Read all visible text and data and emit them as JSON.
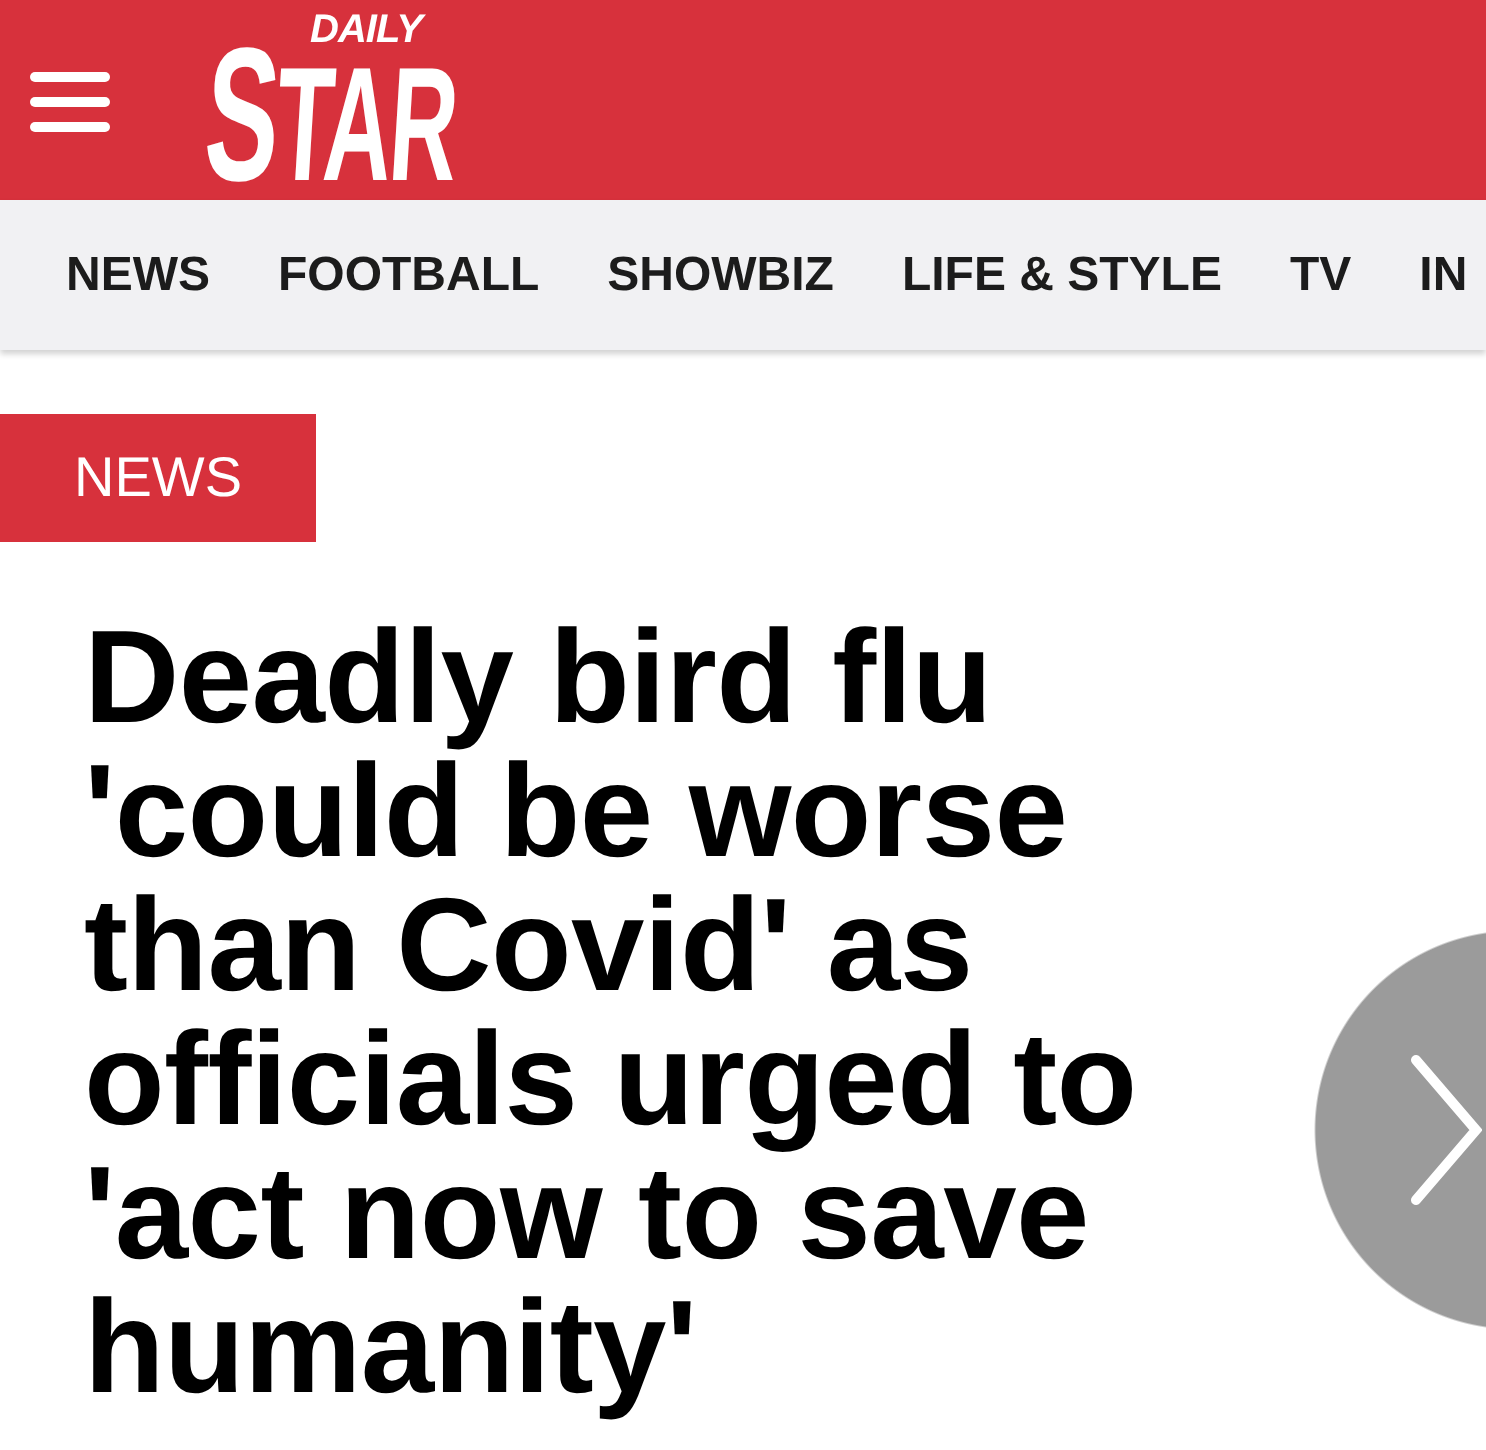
{
  "header": {
    "logo": {
      "small": "DAILY",
      "large": "STAR"
    }
  },
  "nav": {
    "items": [
      "NEWS",
      "FOOTBALL",
      "SHOWBIZ",
      "LIFE & STYLE",
      "TV",
      "IN"
    ]
  },
  "article": {
    "section": "NEWS",
    "headline": "Deadly bird flu 'could be worse than Covid' as officials urged to 'act now to save humanity'"
  }
}
